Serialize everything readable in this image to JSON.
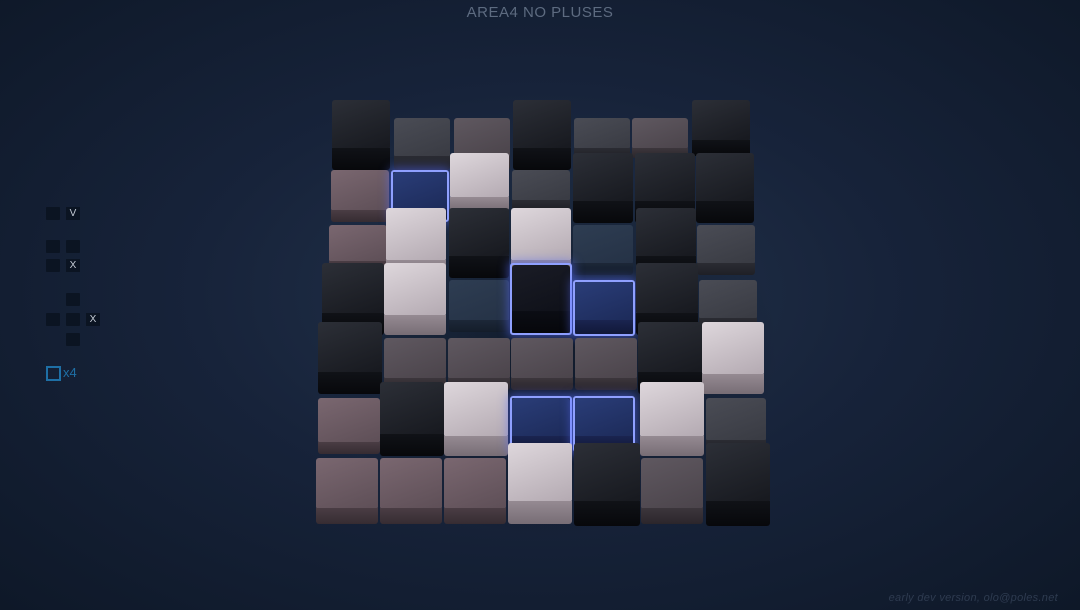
{
  "header": {
    "title": "AREA4 NO PLUSES"
  },
  "footer": {
    "text": "early dev version, olo@poles.net"
  },
  "legend": {
    "rules": [
      {
        "symbol": "V",
        "description_icon": "single-cell-pattern"
      },
      {
        "symbol": "X",
        "description_icon": "three-cell-L-pattern"
      },
      {
        "symbol": "X",
        "description_icon": "plus-pattern"
      }
    ],
    "counter": {
      "icon": "square-outline-icon",
      "label": "x4"
    }
  },
  "colors": {
    "background": "#17233a",
    "glow": "#8fa0ff",
    "counter": "#1e6fa5"
  }
}
